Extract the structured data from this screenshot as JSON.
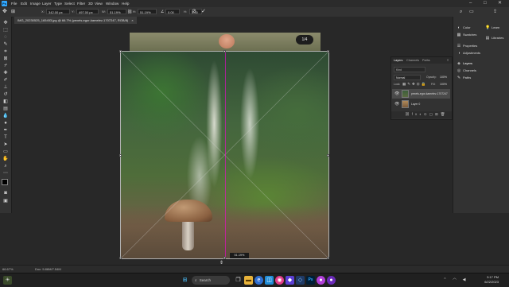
{
  "menubar": {
    "logo": "Ps",
    "menus": [
      "File",
      "Edit",
      "Image",
      "Layer",
      "Type",
      "Select",
      "Filter",
      "3D",
      "View",
      "Window",
      "Help"
    ],
    "window_controls": {
      "minimize": "–",
      "maximize": "□",
      "close": "✕"
    }
  },
  "options_bar": {
    "x_label": "X:",
    "x_value": "342.00 px",
    "y_label": "Y:",
    "y_value": "497.00 px",
    "w_label": "W:",
    "w_value": "51.19%",
    "h_label": "H:",
    "h_value": "51.19%",
    "angle_value": "0.00",
    "h_skew": "H:",
    "h_skew_value": "0.00",
    "v_skew": "V:",
    "v_skew_value": "0.00"
  },
  "document_tab": {
    "label": "IMG_20230525_165453.jpg @ 66.7% (pexels-egor-kamelev-1707247, RGB/8)",
    "close": "×"
  },
  "canvas": {
    "page_indicator": "1/4",
    "dimension_readout": "51.19%"
  },
  "status_bar": {
    "zoom": "66.67%",
    "doc_info": "Doc: 5.86M/7.54M"
  },
  "layers_panel": {
    "tabs": [
      "Layers",
      "Channels",
      "Paths"
    ],
    "search_placeholder": "Kind",
    "blend_mode": "Normal",
    "opacity_label": "Opacity:",
    "opacity_value": "100%",
    "lock_label": "Lock:",
    "fill_label": "Fill:",
    "fill_value": "100%",
    "layers": [
      {
        "name": "pexels-egor-kamelev-1707247"
      },
      {
        "name": "Layer 0"
      }
    ]
  },
  "right_dock": {
    "col1": [
      {
        "icon": "color-icon",
        "label": "Color"
      },
      {
        "icon": "swatches-icon",
        "label": "Swatches"
      },
      {
        "icon": "properties-icon",
        "label": "Properties"
      },
      {
        "icon": "adjustments-icon",
        "label": "Adjustments"
      },
      {
        "icon": "layers-icon",
        "label": "Layers"
      },
      {
        "icon": "channels-icon",
        "label": "Channels"
      },
      {
        "icon": "paths-icon",
        "label": "Paths"
      }
    ],
    "col2": [
      {
        "icon": "learn-icon",
        "label": "Learn"
      },
      {
        "icon": "libraries-icon",
        "label": "Libraries"
      }
    ]
  },
  "taskbar": {
    "search_label": "Search",
    "time": "3:17 PM",
    "date": "6/22/2023"
  }
}
